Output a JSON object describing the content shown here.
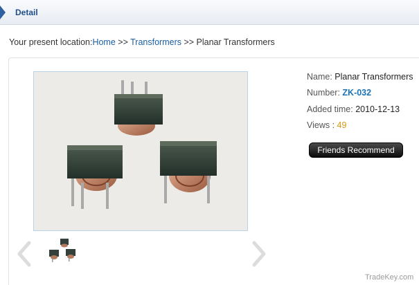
{
  "header": {
    "title": "Detail"
  },
  "breadcrumb": {
    "prefix": "Your present location:",
    "home": "Home",
    "sep1": " >> ",
    "category": "Transformers",
    "sep2": " >> ",
    "current": "Planar Transformers"
  },
  "product": {
    "name_label": "Name: ",
    "name": "Planar Transformers",
    "number_label": "Number: ",
    "number": "ZK-032",
    "added_label": "Added time: ",
    "added": "2010-12-13",
    "views_label": "Views : ",
    "views": "49"
  },
  "actions": {
    "friends_recommend": "Friends Recommend"
  },
  "gallery": {
    "main_image_icon": "product-photo",
    "prev_icon": "chevron-left-icon",
    "next_icon": "chevron-right-icon"
  },
  "watermark": "TradeKey.com",
  "colors": {
    "link": "#1a5ea3",
    "product_code": "#1a72b6",
    "views_count": "#d09a12",
    "header_title": "#1f4f8a"
  }
}
